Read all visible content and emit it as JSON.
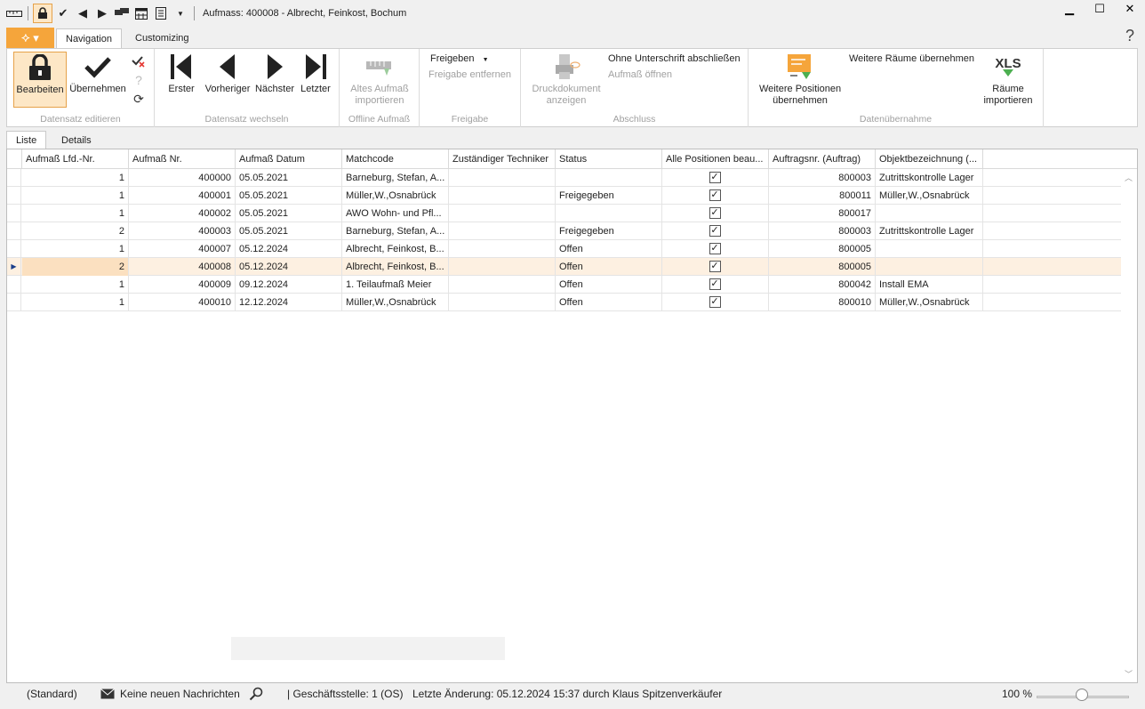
{
  "window": {
    "title": "Aufmass: 400008 - Albrecht, Feinkost, Bochum",
    "controls": [
      "minimize",
      "maximize",
      "close"
    ]
  },
  "tabs": {
    "navigation": "Navigation",
    "customizing": "Customizing",
    "help": "?"
  },
  "ribbon": {
    "groups": {
      "datensatz_editieren": "Datensatz editieren",
      "datensatz_wechseln": "Datensatz wechseln",
      "offline_aufmass": "Offline Aufmaß",
      "freigabe": "Freigabe",
      "abschluss": "Abschluss",
      "datenuebernahme": "Datenübernahme"
    },
    "buttons": {
      "bearbeiten": "Bearbeiten",
      "uebernehmen": "Übernehmen",
      "erster": "Erster",
      "vorheriger": "Vorheriger",
      "naechster": "Nächster",
      "letzter": "Letzter",
      "altes_aufmass_1": "Altes Aufmaß",
      "altes_aufmass_2": "importieren",
      "freigeben": "Freigeben",
      "freigabe_entfernen": "Freigabe entfernen",
      "druckdokument_1": "Druckdokument",
      "druckdokument_2": "anzeigen",
      "ohne_unterschrift": "Ohne Unterschrift abschließen",
      "aufmass_oeffnen": "Aufmaß öffnen",
      "weitere_positionen_1": "Weitere Positionen",
      "weitere_positionen_2": "übernehmen",
      "weitere_raeume": "Weitere Räume übernehmen",
      "xls": "XLS",
      "raeume_importieren_1": "Räume",
      "raeume_importieren_2": "importieren"
    }
  },
  "subtabs": {
    "liste": "Liste",
    "details": "Details"
  },
  "grid": {
    "columns": [
      "Aufmaß Lfd.-Nr.",
      "Aufmaß Nr.",
      "Aufmaß Datum",
      "Matchcode",
      "Zuständiger Techniker",
      "Status",
      "Alle Positionen beau...",
      "Auftragsnr. (Auftrag)",
      "Objektbezeichnung (..."
    ],
    "rows": [
      {
        "lfd": "1",
        "nr": "400000",
        "datum": "05.05.2021",
        "match": "Barneburg, Stefan, A...",
        "tech": "",
        "status": "",
        "alle": true,
        "auftrag": "800003",
        "objekt": "Zutrittskontrolle Lager"
      },
      {
        "lfd": "1",
        "nr": "400001",
        "datum": "05.05.2021",
        "match": "Müller,W.,Osnabrück",
        "tech": "",
        "status": "Freigegeben",
        "alle": true,
        "auftrag": "800011",
        "objekt": "Müller,W.,Osnabrück"
      },
      {
        "lfd": "1",
        "nr": "400002",
        "datum": "05.05.2021",
        "match": "AWO Wohn- und Pfl...",
        "tech": "",
        "status": "",
        "alle": true,
        "auftrag": "800017",
        "objekt": ""
      },
      {
        "lfd": "2",
        "nr": "400003",
        "datum": "05.05.2021",
        "match": "Barneburg, Stefan, A...",
        "tech": "",
        "status": "Freigegeben",
        "alle": true,
        "auftrag": "800003",
        "objekt": "Zutrittskontrolle Lager"
      },
      {
        "lfd": "1",
        "nr": "400007",
        "datum": "05.12.2024",
        "match": "Albrecht, Feinkost, B...",
        "tech": "",
        "status": "Offen",
        "alle": true,
        "auftrag": "800005",
        "objekt": ""
      },
      {
        "lfd": "2",
        "nr": "400008",
        "datum": "05.12.2024",
        "match": "Albrecht, Feinkost, B...",
        "tech": "",
        "status": "Offen",
        "alle": true,
        "auftrag": "800005",
        "objekt": ""
      },
      {
        "lfd": "1",
        "nr": "400009",
        "datum": "09.12.2024",
        "match": "1. Teilaufmaß Meier",
        "tech": "",
        "status": "Offen",
        "alle": true,
        "auftrag": "800042",
        "objekt": "Install EMA"
      },
      {
        "lfd": "1",
        "nr": "400010",
        "datum": "12.12.2024",
        "match": "Müller,W.,Osnabrück",
        "tech": "",
        "status": "Offen",
        "alle": true,
        "auftrag": "800010",
        "objekt": "Müller,W.,Osnabrück"
      }
    ],
    "selected_row": 5
  },
  "statusbar": {
    "layout": "(Standard)",
    "messages": "Keine neuen Nachrichten",
    "branch": "| Geschäftsstelle:  1 (OS)",
    "last_change": "Letzte Änderung: 05.12.2024 15:37 durch Klaus Spitzenverkäufer",
    "zoom": "100 %"
  },
  "colors": {
    "accent": "#f5a53b",
    "selection_bg": "#fde7c6",
    "row_selected": "#fdf0e1"
  }
}
